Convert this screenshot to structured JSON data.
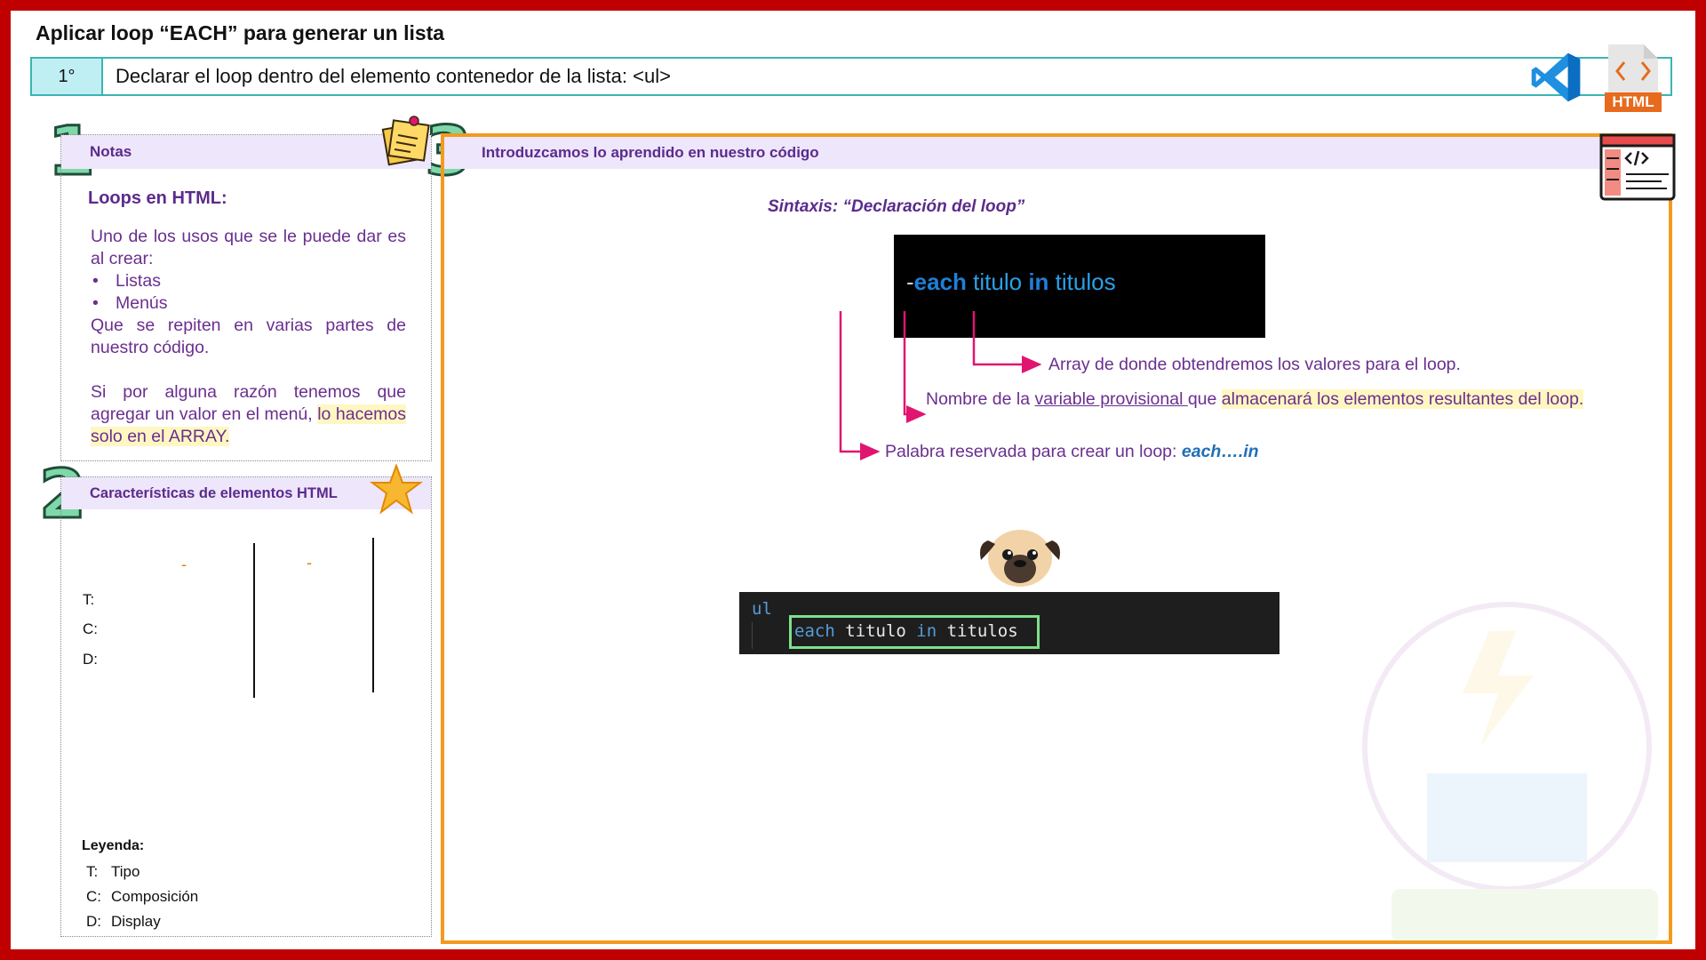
{
  "slide": {
    "title": "Aplicar loop “EACH” para generar un lista",
    "step_number": "1°",
    "step_text": "Declarar el loop  dentro del elemento contenedor de la lista: <ul>",
    "html_icon_label": "HTML"
  },
  "sections": {
    "notes_number": "1",
    "chars_number": "2",
    "main_number": "3"
  },
  "notes": {
    "header": "Notas",
    "subtitle": "Loops en HTML:",
    "intro": "Uno de los usos que se le puede dar es al crear:",
    "items": [
      "Listas",
      "Menús"
    ],
    "repeat_text": "Que se repiten en varias partes de nuestro código.",
    "para2_a": "Si por alguna razón tenemos que agregar un valor en el menú, ",
    "para2_b": "lo hacemos solo en el ARRAY."
  },
  "characteristics": {
    "header": "Características de elementos HTML",
    "dash1": "-",
    "dash2": "-",
    "rows": [
      "T:",
      "C:",
      "D:"
    ],
    "legend_title": "Leyenda:",
    "legend": [
      {
        "key": "T:",
        "value": "Tipo"
      },
      {
        "key": "C:",
        "value": "Composición"
      },
      {
        "key": "D:",
        "value": "Display"
      }
    ]
  },
  "main": {
    "header": "Introduzcamos lo aprendido en nuestro código",
    "syntax_label": "Sintaxis: “Declaración del loop”",
    "code": {
      "dash": "-",
      "kw_each": "each",
      "var": " titulo ",
      "kw_in": "in",
      "arr": " titulos"
    },
    "annotations": {
      "array": "Array de donde obtendremos los valores para el loop.",
      "var_a": "Nombre de la ",
      "var_u": "variable provisional ",
      "var_b": "que ",
      "var_hl": "almacenará los elementos resultantes del loop.",
      "reserved": "Palabra reservada para crear un loop:  ",
      "reserved_kw": "each….in"
    },
    "editor": {
      "line1": "ul",
      "kw_each": "each",
      "var": " titulo ",
      "kw_in": "in",
      "arr": " titulos"
    }
  },
  "colors": {
    "frame": "#c00000",
    "accent_purple": "#5b2b8c",
    "panel_orange": "#f39a1f",
    "header_lavender": "#eee6fb",
    "step_teal": "#3bb4b4",
    "arrow_pink": "#e0156f",
    "highlight_yellow": "#fff7c2"
  }
}
